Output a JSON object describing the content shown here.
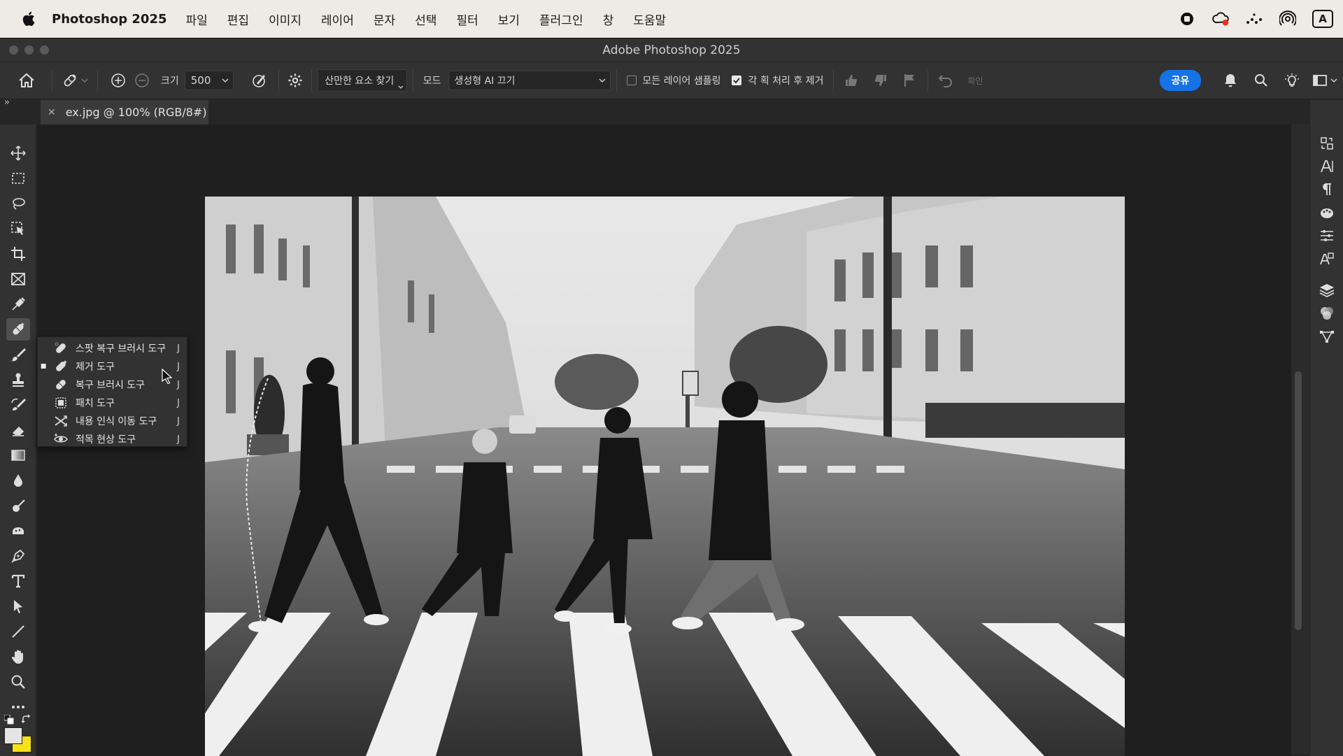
{
  "menubar": {
    "app_name": "Photoshop 2025",
    "items": [
      "파일",
      "편집",
      "이미지",
      "레이어",
      "문자",
      "선택",
      "필터",
      "보기",
      "플러그인",
      "창",
      "도움말"
    ],
    "status_icons": [
      "record-icon",
      "creative-cloud-icon",
      "dots-icon",
      "airdrop-icon",
      "input-source-icon"
    ],
    "input_source_label": "A"
  },
  "window": {
    "title": "Adobe Photoshop 2025"
  },
  "options": {
    "size_label": "크기",
    "size_value": "500",
    "find_distractions_label": "산만한 요소 찾기",
    "mode_label": "모드",
    "mode_value": "생성형 AI 끄기",
    "sample_all_layers_label": "모든 레이어 샘플링",
    "sample_all_layers_checked": false,
    "remove_after_stroke_label": "각 획 처리 후 제거",
    "remove_after_stroke_checked": true,
    "confirm_label": "확인",
    "share_label": "공유"
  },
  "document": {
    "tab_label": "ex.jpg @ 100% (RGB/8#)"
  },
  "flyout": {
    "items": [
      {
        "label": "스팟 복구 브러시 도구",
        "shortcut": "J",
        "icon": "spot-healing-brush-icon",
        "selected": false
      },
      {
        "label": "제거 도구",
        "shortcut": "J",
        "icon": "remove-tool-icon",
        "selected": true
      },
      {
        "label": "복구 브러시 도구",
        "shortcut": "J",
        "icon": "healing-brush-icon",
        "selected": false
      },
      {
        "label": "패치 도구",
        "shortcut": "J",
        "icon": "patch-tool-icon",
        "selected": false
      },
      {
        "label": "내용 인식 이동 도구",
        "shortcut": "J",
        "icon": "content-aware-move-icon",
        "selected": false
      },
      {
        "label": "적목 현상 도구",
        "shortcut": "J",
        "icon": "red-eye-tool-icon",
        "selected": false
      }
    ]
  },
  "colors": {
    "accent": "#1473e6",
    "foreground_swatch": "#e5e5e5",
    "background_swatch": "#f5e11a"
  }
}
